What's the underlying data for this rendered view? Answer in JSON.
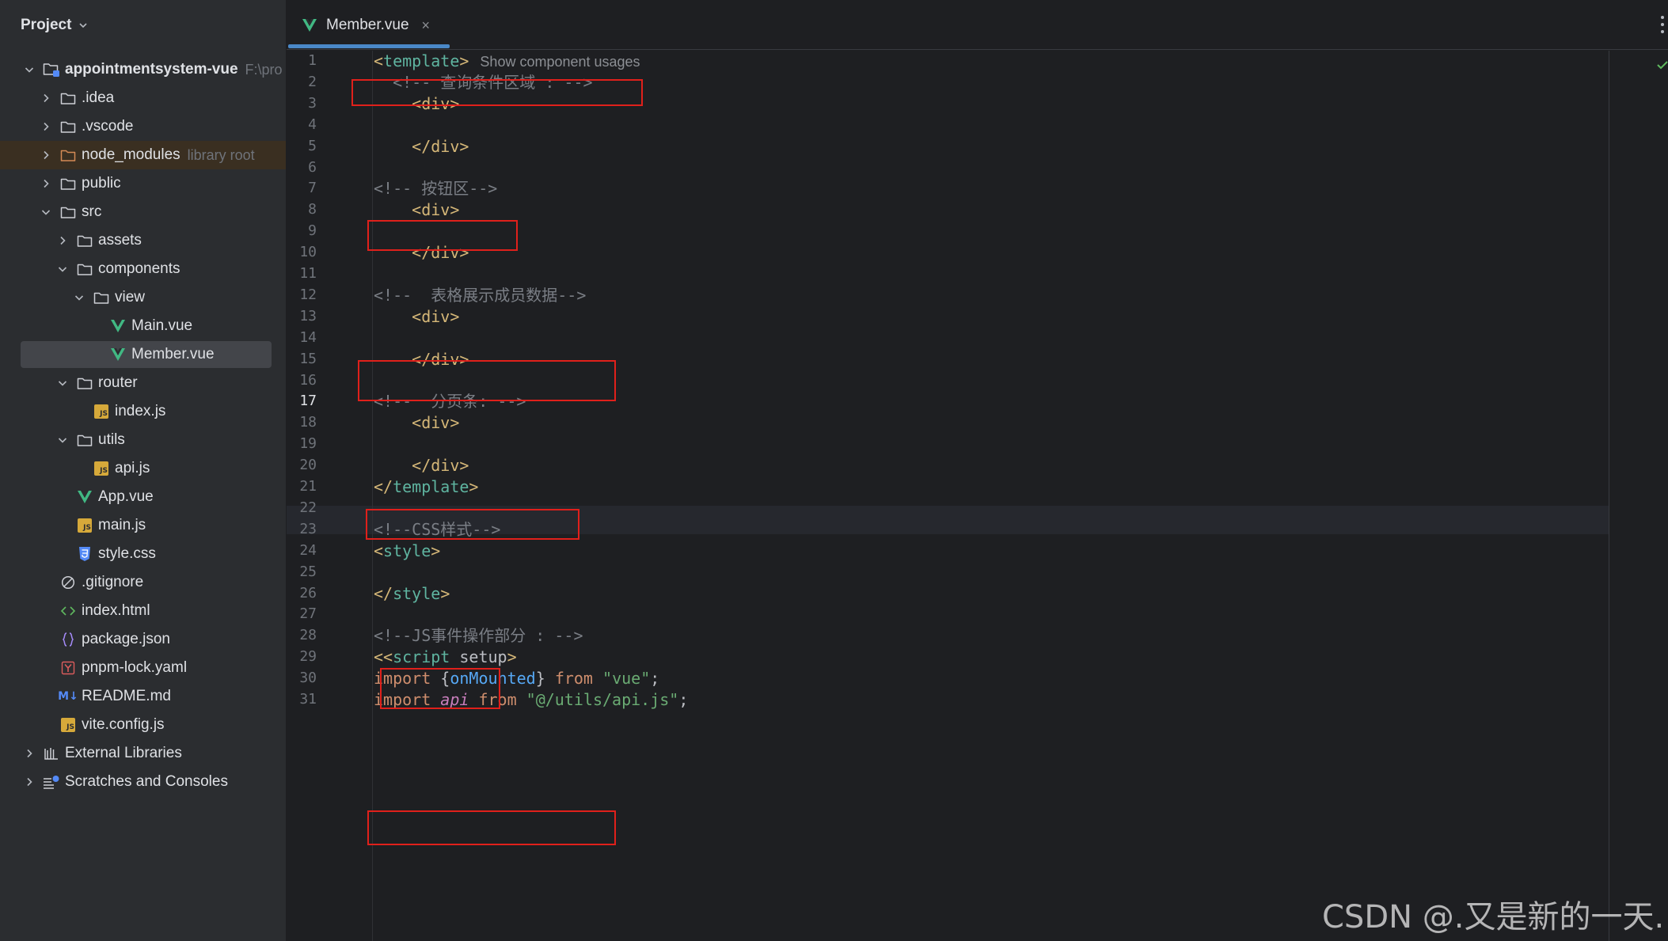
{
  "sidebar": {
    "title": "Project",
    "tree": [
      {
        "label": "appointmentsystem-vue",
        "suffix": "F:\\pro",
        "icon": "project-folder-icon",
        "indent": 0,
        "arrow": "down",
        "bold": true
      },
      {
        "label": ".idea",
        "icon": "folder-icon",
        "indent": 1,
        "arrow": "right"
      },
      {
        "label": ".vscode",
        "icon": "folder-icon",
        "indent": 1,
        "arrow": "right"
      },
      {
        "label": "node_modules",
        "suffix": "library root",
        "icon": "folder-orange-icon",
        "indent": 1,
        "arrow": "right",
        "libRoot": true
      },
      {
        "label": "public",
        "icon": "folder-icon",
        "indent": 1,
        "arrow": "right"
      },
      {
        "label": "src",
        "icon": "folder-icon",
        "indent": 1,
        "arrow": "down"
      },
      {
        "label": "assets",
        "icon": "folder-icon",
        "indent": 2,
        "arrow": "right"
      },
      {
        "label": "components",
        "icon": "folder-icon",
        "indent": 2,
        "arrow": "down"
      },
      {
        "label": "view",
        "icon": "folder-icon",
        "indent": 3,
        "arrow": "down"
      },
      {
        "label": "Main.vue",
        "icon": "vue-file-icon",
        "indent": 4,
        "arrow": "none"
      },
      {
        "label": "Member.vue",
        "icon": "vue-file-icon",
        "indent": 4,
        "arrow": "none",
        "selected": true
      },
      {
        "label": "router",
        "icon": "folder-icon",
        "indent": 2,
        "arrow": "down"
      },
      {
        "label": "index.js",
        "icon": "js-file-icon",
        "indent": 3,
        "arrow": "none"
      },
      {
        "label": "utils",
        "icon": "folder-icon",
        "indent": 2,
        "arrow": "down"
      },
      {
        "label": "api.js",
        "icon": "js-file-icon",
        "indent": 3,
        "arrow": "none"
      },
      {
        "label": "App.vue",
        "icon": "vue-file-icon",
        "indent": 2,
        "arrow": "none"
      },
      {
        "label": "main.js",
        "icon": "js-file-icon",
        "indent": 2,
        "arrow": "none"
      },
      {
        "label": "style.css",
        "icon": "css-file-icon",
        "indent": 2,
        "arrow": "none"
      },
      {
        "label": ".gitignore",
        "icon": "gitignore-file-icon",
        "indent": 1,
        "arrow": "none"
      },
      {
        "label": "index.html",
        "icon": "html-file-icon",
        "indent": 1,
        "arrow": "none"
      },
      {
        "label": "package.json",
        "icon": "json-file-icon",
        "indent": 1,
        "arrow": "none"
      },
      {
        "label": "pnpm-lock.yaml",
        "icon": "yaml-file-icon",
        "indent": 1,
        "arrow": "none"
      },
      {
        "label": "README.md",
        "icon": "markdown-file-icon",
        "indent": 1,
        "arrow": "none"
      },
      {
        "label": "vite.config.js",
        "icon": "js-file-icon",
        "indent": 1,
        "arrow": "none"
      },
      {
        "label": "External Libraries",
        "icon": "external-libraries-icon",
        "indent": 0,
        "arrow": "right"
      },
      {
        "label": "Scratches and Consoles",
        "icon": "scratches-icon",
        "indent": 0,
        "arrow": "right"
      }
    ]
  },
  "editor": {
    "tab": {
      "label": "Member.vue",
      "close": "×"
    },
    "current_line": 17,
    "inlay_hint": "Show component usages",
    "lines": [
      [
        {
          "t": "<",
          "c": "punct"
        },
        {
          "t": "template",
          "c": "tmpl"
        },
        {
          "t": ">",
          "c": "punct"
        }
      ],
      [
        {
          "t": "  <!-- 查询条件区域 : -->",
          "c": "comment"
        }
      ],
      [
        {
          "t": "    <div>",
          "c": "tag"
        }
      ],
      [],
      [
        {
          "t": "    </div>",
          "c": "tag"
        }
      ],
      [],
      [
        {
          "t": "<!-- 按钮区-->",
          "c": "comment"
        }
      ],
      [
        {
          "t": "    <div>",
          "c": "tag"
        }
      ],
      [],
      [
        {
          "t": "    </div>",
          "c": "tag"
        }
      ],
      [],
      [
        {
          "t": "<!--  表格展示成员数据-->",
          "c": "comment"
        }
      ],
      [
        {
          "t": "    <div>",
          "c": "tag"
        }
      ],
      [],
      [
        {
          "t": "    </div>",
          "c": "tag"
        }
      ],
      [],
      [
        {
          "t": "<!--  分页条: -->",
          "c": "comment"
        }
      ],
      [
        {
          "t": "    <div>",
          "c": "tag"
        }
      ],
      [],
      [
        {
          "t": "    </div>",
          "c": "tag"
        }
      ],
      [
        {
          "t": "</",
          "c": "punct"
        },
        {
          "t": "template",
          "c": "tmpl"
        },
        {
          "t": ">",
          "c": "punct"
        }
      ],
      [],
      [
        {
          "t": "<!--CSS样式-->",
          "c": "comment"
        }
      ],
      [
        {
          "t": "<",
          "c": "punct"
        },
        {
          "t": "style",
          "c": "tmpl"
        },
        {
          "t": ">",
          "c": "punct"
        }
      ],
      [],
      [
        {
          "t": "</",
          "c": "punct"
        },
        {
          "t": "style",
          "c": "tmpl"
        },
        {
          "t": ">",
          "c": "punct"
        }
      ],
      [],
      [
        {
          "t": "<!--JS事件操作部分 : -->",
          "c": "comment"
        }
      ],
      [
        {
          "t": "<<",
          "c": "punct"
        },
        {
          "t": "script",
          "c": "tmpl"
        },
        {
          "t": " setup",
          "c": "plain"
        },
        {
          "t": ">",
          "c": "punct"
        }
      ],
      [
        {
          "t": "import ",
          "c": "kw"
        },
        {
          "t": "{",
          "c": "plain"
        },
        {
          "t": "onMounted",
          "c": "imp"
        },
        {
          "t": "} ",
          "c": "plain"
        },
        {
          "t": "from ",
          "c": "kw"
        },
        {
          "t": "\"vue\"",
          "c": "str"
        },
        {
          "t": ";",
          "c": "plain"
        }
      ],
      [
        {
          "t": "import ",
          "c": "kw"
        },
        {
          "t": "api",
          "c": "api"
        },
        {
          "t": " from ",
          "c": "kw"
        },
        {
          "t": "\"@/utils/api.js\"",
          "c": "str"
        },
        {
          "t": ";",
          "c": "plain"
        }
      ]
    ]
  },
  "watermark": "CSDN @.又是新的一天.",
  "colors": {
    "background": "#1e1f22",
    "sidebar": "#2b2d30",
    "accent": "#4a88c7",
    "annotation_box": "#e0201b",
    "vue_green": "#41b883"
  }
}
